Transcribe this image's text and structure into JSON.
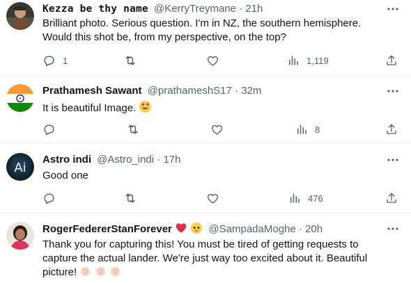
{
  "tweets": [
    {
      "name": "Kezza be thy name",
      "handle": "@KerryTreymane",
      "sep": "·",
      "time": "21h",
      "text": [
        "Brilliant photo. Serious question. I'm in NZ, the southern hemisphere.",
        "Would this shot be, from my perspective, on the top?"
      ],
      "replies": "1",
      "retweets": "",
      "likes": "",
      "views": "1,119",
      "avatar": "avatar-photo-dark"
    },
    {
      "name": "Prathamesh Sawant",
      "handle": "@prathameshS17",
      "sep": "·",
      "time": "32m",
      "text": [
        "It is beautiful Image."
      ],
      "replies": "",
      "retweets": "",
      "likes": "",
      "views": "8",
      "avatar": "avatar-india-flag"
    },
    {
      "name": "Astro indi",
      "handle": "@Astro_indi",
      "sep": "·",
      "time": "17h",
      "text": [
        "Good one"
      ],
      "replies": "",
      "retweets": "",
      "likes": "",
      "views": "476",
      "avatar": "avatar-ai-logo",
      "avatar_text": "Ai"
    },
    {
      "name": "RogerFedererStanForever",
      "handle": "@SampadaMoghe",
      "sep": "·",
      "time": "20h",
      "text": [
        "Thank you for capturing this! You must be tired of getting requests to",
        "capture the actual lander. We're just way too excited about it. Beautiful",
        "picture!"
      ],
      "avatar": "avatar-photo-woman"
    }
  ],
  "colors": {
    "text": "#0f1419",
    "secondary": "#536471",
    "divider": "#eff3f4",
    "heart_red": "#e0245e",
    "emoji_yellow": "#ffcc4d"
  },
  "icons": [
    "reply-icon",
    "retweet-icon",
    "like-icon",
    "views-icon",
    "share-icon",
    "more-icon"
  ]
}
